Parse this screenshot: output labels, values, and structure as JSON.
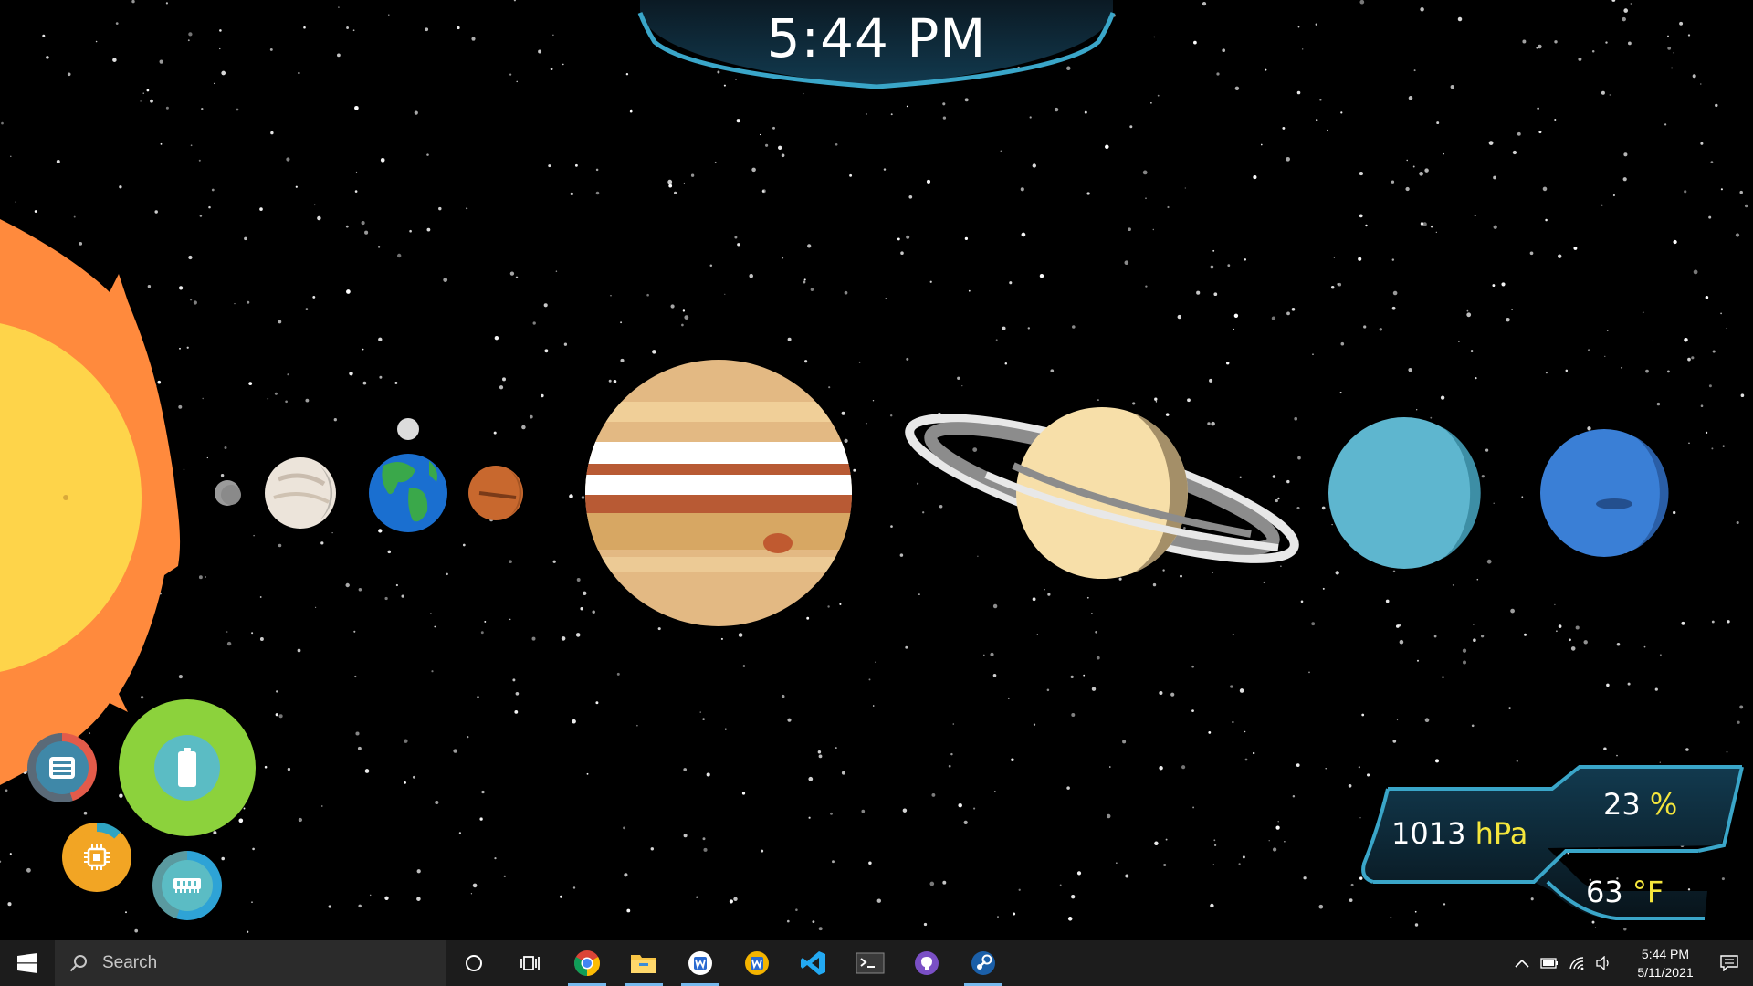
{
  "desktop": {
    "clock_time": "5:44 PM",
    "weather": {
      "pressure_value": "1013",
      "pressure_unit": "hPa",
      "humidity_value": "23",
      "humidity_unit": "%",
      "temperature_value": "63",
      "temperature_unit": "°F"
    },
    "monitors": [
      {
        "name": "storage-monitor",
        "icon": "storage-icon"
      },
      {
        "name": "battery-monitor",
        "icon": "battery-icon"
      },
      {
        "name": "cpu-monitor",
        "icon": "cpu-icon"
      },
      {
        "name": "ram-monitor",
        "icon": "ram-icon"
      }
    ],
    "planets": [
      "Mercury",
      "Venus",
      "Earth",
      "Mars",
      "Jupiter",
      "Saturn",
      "Uranus",
      "Neptune"
    ],
    "colors": {
      "accent_cyan": "#3aa6c9",
      "widget_unit_yellow": "#f5e63c",
      "battery_green": "#8cd23c",
      "cpu_orange": "#f2a524",
      "sun_yellow": "#fed44a",
      "sun_corona": "#ff8a3d"
    }
  },
  "taskbar": {
    "search_placeholder": "Search",
    "apps": [
      {
        "name": "cortana-icon",
        "active": false
      },
      {
        "name": "task-view-icon",
        "active": false
      },
      {
        "name": "chrome-icon",
        "active": true
      },
      {
        "name": "file-explorer-icon",
        "active": true
      },
      {
        "name": "app-w-blue-icon",
        "active": true
      },
      {
        "name": "app-w-yellow-icon",
        "active": false
      },
      {
        "name": "vscode-icon",
        "active": false
      },
      {
        "name": "terminal-icon",
        "active": false
      },
      {
        "name": "github-desktop-icon",
        "active": false
      },
      {
        "name": "steam-icon",
        "active": true
      }
    ],
    "tray": {
      "time": "5:44 PM",
      "date": "5/11/2021",
      "icons": [
        "chevron-up-icon",
        "battery-icon",
        "wifi-icon",
        "volume-icon"
      ]
    }
  }
}
